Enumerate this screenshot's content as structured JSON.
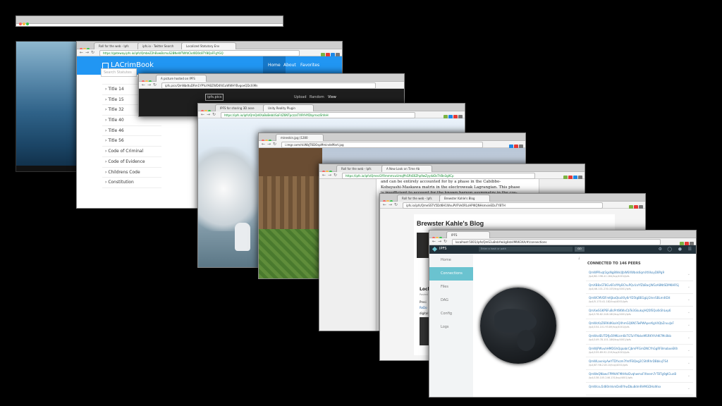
{
  "windows": {
    "w1": {
      "tabs": []
    },
    "w2": {
      "tabs": [
        "",
        ""
      ],
      "url": ""
    },
    "w3": {
      "tabs": [
        "Roll for the web - Ipfs",
        "ipfs.io - Twitter Search",
        "Localized Statutory Env"
      ],
      "url": "https://gateway.ipfs.io/ipfs/QmbeZ2hBvwBcmuS2BNeWTWfdCkd0D0c8TY8QaFFgYGQ",
      "brand": "LACrimBook",
      "nav": [
        "Home",
        "About",
        "Favorites"
      ],
      "search_placeholder": "Search Statutes",
      "items": [
        "Title 14",
        "Title 15",
        "Title 32",
        "Title 40",
        "Title 46",
        "Title 56",
        "Code of Criminal",
        "Code of Evidence",
        "Childrens Code",
        "Constitution"
      ]
    },
    "w4": {
      "tab": "A picture hosted on IPFS",
      "url": "ipfs.pics/QmNbdtuDRm1YPYuYABZWD4fd1aWWHYBvgoeQDcXiMn",
      "logo": "ipfs.pics",
      "nav": [
        "Upload",
        "Random",
        "View"
      ]
    },
    "w5": {
      "tabs": [
        "IPFS for sharing 3D asse",
        "Unity Reality Plugin"
      ],
      "url": "https://ipfs.io/ipfs/QmQsKXaBoBebUSaF4Z6NTpczzsTX9YHYDbymxzShfeH"
    },
    "w6": {
      "tab": "mineskin.jpg (1280",
      "url": "i.imgr.com/rkiWbJT6DOspMmindeMart.jpg"
    },
    "w7": {
      "tabs": [
        "Roll for the web - Ipfs",
        "A New Look on Time Ab"
      ],
      "url": "https://ipfs.io/ipfs/QmecGYRmmmcuUmqPhGPzE6Zhp9wZyydzDsTVBe3gXCp",
      "text": [
        "and can be entirely accounted for by a phase in the Cabibbo-",
        "Kobayashi-Maskawa matrix in the electroweak Lagrangian. This phase",
        "is insufficient to account for the known baryon asymmetry in the cos-"
      ]
    },
    "w8": {
      "tabs": [
        "Roll for the web - Ipfs",
        "Brewster Kahle's Blog"
      ],
      "url": "ipfs.io/ipfs/QmeSSTV5Dd6H1WvuPVFVeORLsHPlKQNHsmxieEDuTYBTH",
      "title": "Brewster Kahle's Blog",
      "frag1": "Lock",
      "frag2": "Posted",
      "frag3": "Presi",
      "frag4": "ReDo",
      "frag5": "digital"
    },
    "w9": {
      "tab": "IPFS",
      "url": "localhost:5001/ipfs/QmS1u8nbYwUg0sbVMIW3XA/#/connections",
      "brand": "IPFS",
      "search_placeholder": "Enter a hash or path",
      "go": "GO",
      "nav": [
        "Home",
        "Connections",
        "Files",
        "DAG",
        "Config",
        "Logs"
      ],
      "heading": "CONNECTED TO 146 PEERS",
      "peers": [
        {
          "id": "QmWPRvqt3gsNg8WoUJbW6XWbsk6qmXtVkoyD8Pg9",
          "addr": "/ip4/82.196.41.184/tcp/4001/ipfs"
        },
        {
          "id": "QmXB8xGT8Gv6FaYMyBChuPQvUaYfZbBacJWGzA8NtSDMKHRSj",
          "addr": "/ip4/46.101.230.105/tcp/4001/ipfs"
        },
        {
          "id": "QmWCMVDFmKJboQkaXXy6rYD5tgBEGgLjGhnrSBLm4tDit",
          "addr": "/ip4/5.170.41.182/tcp/4001/ipfs"
        },
        {
          "id": "QmXwSGKPSFuBcPrt6KWxCbTe3GkukuJHQ5fEQo4kShLep6",
          "addr": "/ip4/178.62.248.180/tcp/4001/ipfs"
        },
        {
          "id": "QmWcKzZ6RKdKkaIrQXhmGQ6N5TwPWAperKgV4QbZnuvJaF",
          "addr": "/ip4/154.101.93.89/tcp/4001/ipfs"
        },
        {
          "id": "QmWsdEUTDfJa59MLkm6kTGTuYFNskeMSRKYtVHK7Mc8kb",
          "addr": "/ip4/149.78.101.186/tcp/4001/ipfs"
        },
        {
          "id": "QmWjPWvuhHMDGhQqaabrCjbmPFGmDNCYhGgRF8maboeEKh",
          "addr": "/ip4/159.89.92.219/tcp/4001/ipfs"
        },
        {
          "id": "QmWLaxnkyAwYTDYxzm7fmfFBQeg2CSfdRhrDBbkvJ7S4",
          "addr": "/ip4/87.98.218.10/tcp/4001/ipfs"
        },
        {
          "id": "QmWeQNbwcFPMHAFMtHhzDvqhwmxFXteem7rTBTg9gK1unB",
          "addr": "/ip4/138.105.246.131/tcp/4001/ipfs"
        },
        {
          "id": "QmWcsu5d80nhkmDe8YhwDbu8dmRHMGDHaWxx",
          "addr": ""
        }
      ]
    }
  }
}
